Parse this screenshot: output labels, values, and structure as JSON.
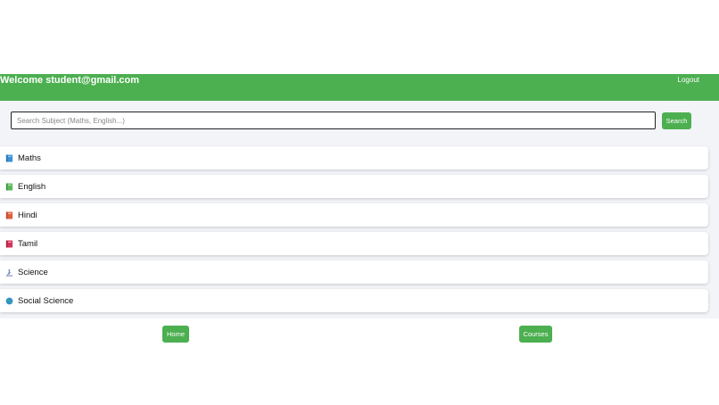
{
  "header": {
    "welcome": "Welcome student@gmail.com",
    "logout": "Logout",
    "background": "#4caf50"
  },
  "search": {
    "placeholder": "Search Subject (Maths, English...)",
    "value": "",
    "button": "Search"
  },
  "subjects": [
    {
      "label": "Maths",
      "icon": "blue-book-icon"
    },
    {
      "label": "English",
      "icon": "green-book-icon"
    },
    {
      "label": "Hindi",
      "icon": "orange-book-icon"
    },
    {
      "label": "Tamil",
      "icon": "red-book-icon"
    },
    {
      "label": "Science",
      "icon": "microscope-icon"
    },
    {
      "label": "Social Science",
      "icon": "globe-icon"
    }
  ],
  "nav": {
    "home": "Home",
    "courses": "Courses"
  }
}
